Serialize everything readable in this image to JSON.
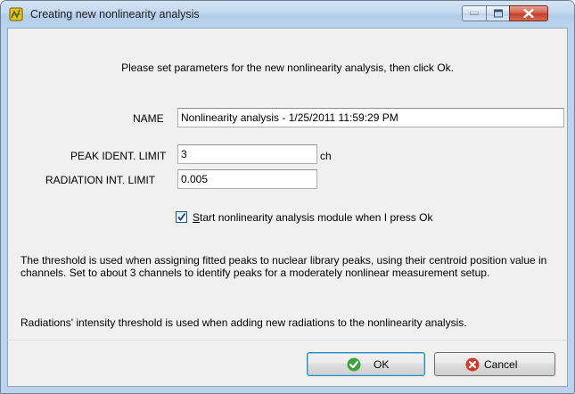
{
  "window": {
    "title": "Creating new nonlinearity analysis",
    "controls": [
      "minimize",
      "maximize",
      "close"
    ]
  },
  "dialog": {
    "intro": "Please set parameters for the new nonlinearity analysis, then click Ok.",
    "name_label": "NAME",
    "name_value": "Nonlinearity analysis - 1/25/2011 11:59:29 PM",
    "peak_label": "PEAK IDENT. LIMIT",
    "peak_value": "3",
    "peak_unit": "ch",
    "radiation_label": "RADIATION INT. LIMIT",
    "radiation_value": "0.005",
    "checkbox_checked": true,
    "checkbox_label_accel": "S",
    "checkbox_label_rest": "tart nonlinearity analysis module when I press Ok",
    "help1": "The threshold is used when assigning fitted peaks to nuclear library peaks, using their centroid position value in channels. Set to about 3 channels to identify peaks for a moderately nonlinear measurement setup.",
    "help2": "Radiations' intensity threshold is used when adding new radiations to the nonlinearity analysis."
  },
  "buttons": {
    "ok": "OK",
    "cancel": "Cancel"
  },
  "colors": {
    "frame": "#bcd3ee",
    "client": "#f0f0f0",
    "ok_icon": "#3fa23c",
    "cancel_icon": "#d23a2c"
  },
  "icons": [
    "app-icon",
    "ok-check-icon",
    "cancel-x-icon",
    "minimize-icon",
    "maximize-icon",
    "close-icon"
  ]
}
